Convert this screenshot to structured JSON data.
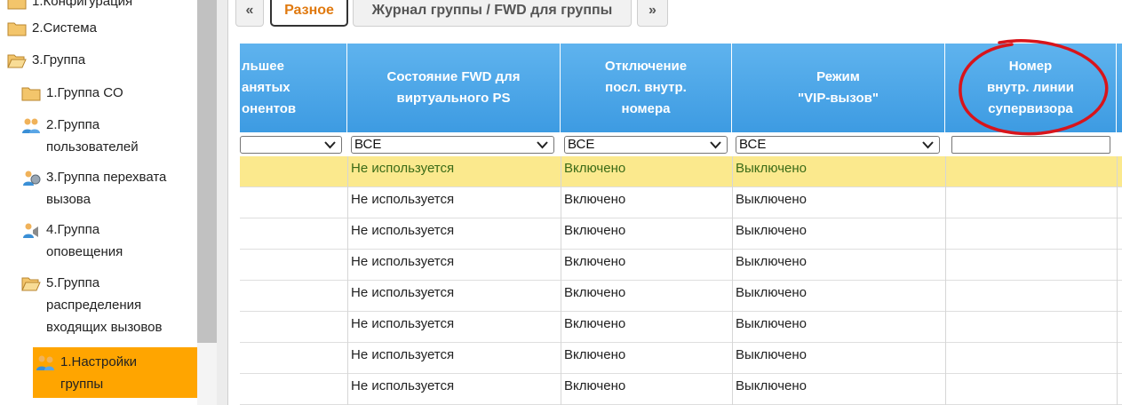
{
  "sidebar": {
    "items": [
      {
        "label": "1.Конфигурация",
        "icon": "folder-icon"
      },
      {
        "label": "2.Система",
        "icon": "folder-icon"
      },
      {
        "label": "3.Группа",
        "icon": "folder-open-icon"
      },
      {
        "label": "1.Группа CO",
        "icon": "folder-icon"
      },
      {
        "label": "2.Группа пользователей",
        "line1": "2.Группа",
        "line2": "пользователей",
        "icon": "users-icon"
      },
      {
        "label": "3.Группа перехвата вызова",
        "line1": "3.Группа перехвата",
        "line2": "вызова",
        "icon": "pickup-group-icon"
      },
      {
        "label": "4.Группа оповещения",
        "line1": "4.Группа",
        "line2": "оповещения",
        "icon": "paging-group-icon"
      },
      {
        "label": "5.Группа распределения входящих вызовов",
        "line1": "5.Группа",
        "line2": "распределения",
        "line3": "входящих вызовов",
        "icon": "folder-open-icon"
      },
      {
        "label": "1.Настройки группы",
        "line1": "1.Настройки",
        "line2": "группы",
        "icon": "group-settings-icon",
        "selected": true
      }
    ]
  },
  "tabs": {
    "prev": "«",
    "misc": "Разное",
    "journal": "Журнал группы / FWD для группы",
    "next": "»"
  },
  "table": {
    "columns": [
      {
        "line1": "льшее",
        "line2": "анятых",
        "line3": "онентов"
      },
      {
        "line1": "Состояние FWD для",
        "line2": "виртуального PS"
      },
      {
        "line1": "Отключение",
        "line2": "посл. внутр.",
        "line3": "номера"
      },
      {
        "line1": "Режим",
        "line2": "\"VIP-вызов\""
      },
      {
        "line1": "Номер",
        "line2": "внутр. линии",
        "line3": "супервизора"
      }
    ],
    "filters": [
      "",
      "ВСЕ",
      "ВСЕ",
      "ВСЕ",
      ""
    ],
    "rows": [
      [
        "",
        "Не используется",
        "Включено",
        "Выключено",
        ""
      ],
      [
        "",
        "Не используется",
        "Включено",
        "Выключено",
        ""
      ],
      [
        "",
        "Не используется",
        "Включено",
        "Выключено",
        ""
      ],
      [
        "",
        "Не используется",
        "Включено",
        "Выключено",
        ""
      ],
      [
        "",
        "Не используется",
        "Включено",
        "Выключено",
        ""
      ],
      [
        "",
        "Не используется",
        "Включено",
        "Выключено",
        ""
      ],
      [
        "",
        "Не используется",
        "Включено",
        "Выключено",
        ""
      ],
      [
        "",
        "Не используется",
        "Включено",
        "Выключено",
        ""
      ]
    ]
  },
  "colors": {
    "header_blue": "#3d9be2",
    "selected_orange": "#ffa500",
    "highlight_row": "#fbe98d",
    "active_tab_text": "#e07a10",
    "annotation_red": "#d8141b"
  }
}
